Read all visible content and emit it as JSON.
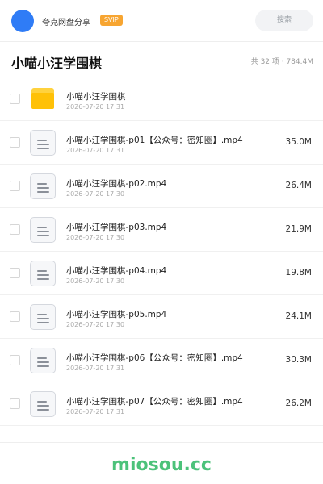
{
  "header": {
    "share_name": "夸克网盘分享",
    "svip_badge": "SVIP",
    "search_placeholder": "搜索",
    "brand_color": "#2f7cf6"
  },
  "folder": {
    "title": "小喵小汪学围棋",
    "summary": "共 32 项 · 784.4M"
  },
  "items": [
    {
      "name": "小喵小汪学围棋",
      "date": "2026-07-20 17:31",
      "size": "",
      "icon": "folder-icon"
    },
    {
      "name": "小喵小汪学围棋-p01【公众号：密知圈】.mp4",
      "date": "2026-07-20 17:31",
      "size": "35.0M",
      "icon": "file-icon"
    },
    {
      "name": "小喵小汪学围棋-p02.mp4",
      "date": "2026-07-20 17:30",
      "size": "26.4M",
      "icon": "file-icon"
    },
    {
      "name": "小喵小汪学围棋-p03.mp4",
      "date": "2026-07-20 17:30",
      "size": "21.9M",
      "icon": "file-icon"
    },
    {
      "name": "小喵小汪学围棋-p04.mp4",
      "date": "2026-07-20 17:30",
      "size": "19.8M",
      "icon": "file-icon"
    },
    {
      "name": "小喵小汪学围棋-p05.mp4",
      "date": "2026-07-20 17:30",
      "size": "24.1M",
      "icon": "file-icon"
    },
    {
      "name": "小喵小汪学围棋-p06【公众号：密知圈】.mp4",
      "date": "2026-07-20 17:31",
      "size": "30.3M",
      "icon": "file-icon"
    },
    {
      "name": "小喵小汪学围棋-p07【公众号：密知圈】.mp4",
      "date": "2026-07-20 17:31",
      "size": "26.2M",
      "icon": "file-icon"
    }
  ],
  "footer": {
    "brand": "miosou.cc",
    "brand_color": "#4cc27a"
  }
}
